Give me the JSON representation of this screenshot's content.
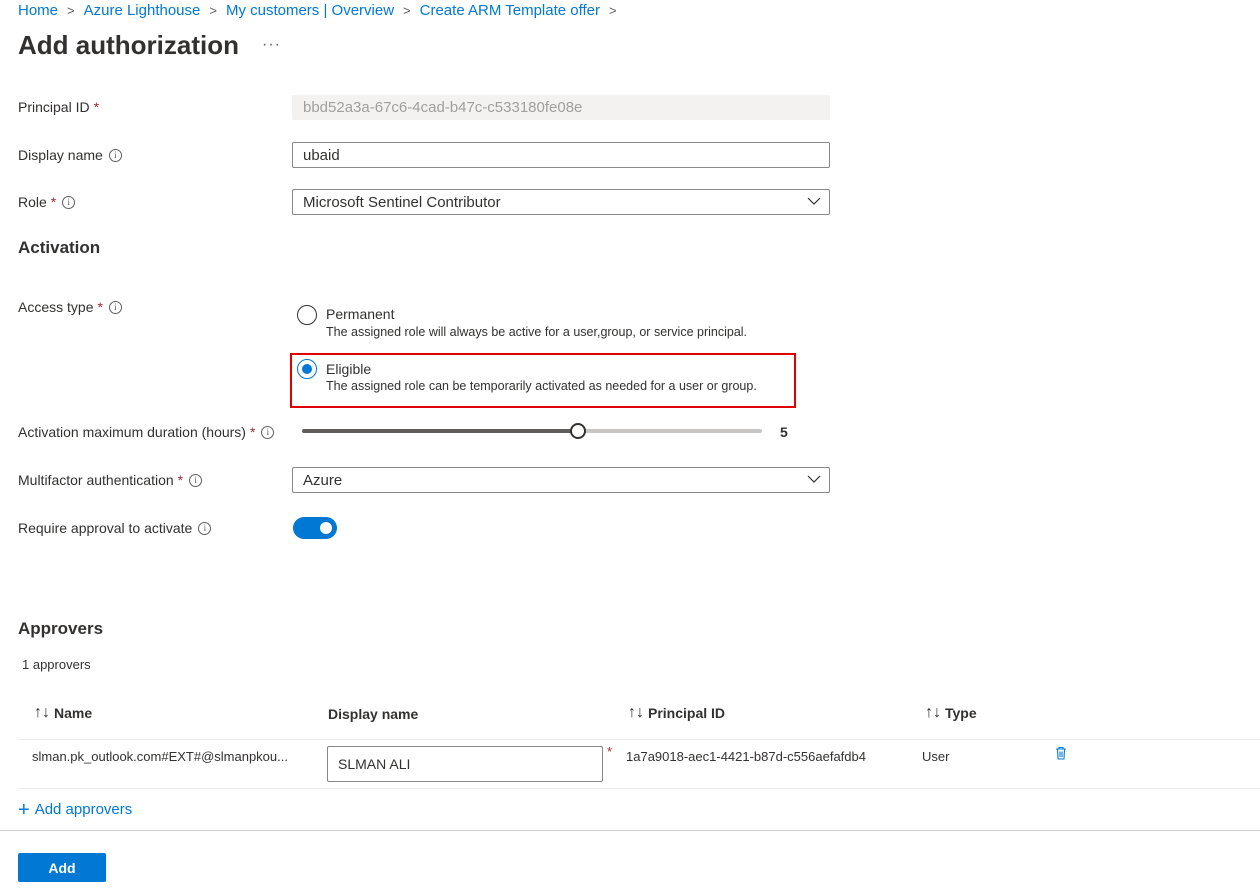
{
  "breadcrumb": [
    "Home",
    "Azure Lighthouse",
    "My customers | Overview",
    "Create ARM Template offer"
  ],
  "page_title": "Add authorization",
  "more_label": "···",
  "form": {
    "principal_id": {
      "label": "Principal ID",
      "value": "bbd52a3a-67c6-4cad-b47c-c533180fe08e"
    },
    "display_name": {
      "label": "Display name",
      "value": "ubaid"
    },
    "role": {
      "label": "Role",
      "value": "Microsoft Sentinel Contributor"
    }
  },
  "activation": {
    "heading": "Activation",
    "access_type_label": "Access type",
    "options": [
      {
        "title": "Permanent",
        "desc": "The assigned role will always be active for a user,group, or service principal.",
        "selected": false
      },
      {
        "title": "Eligible",
        "desc": "The assigned role can be temporarily activated as needed for a user or group.",
        "selected": true
      }
    ],
    "duration_label": "Activation maximum duration (hours)",
    "duration_value": "5",
    "duration_slider_fraction": 0.6,
    "mfa_label": "Multifactor authentication",
    "mfa_value": "Azure",
    "approval_label": "Require approval to activate",
    "approval_enabled": true
  },
  "approvers": {
    "heading": "Approvers",
    "count_text": "1 approvers",
    "columns": [
      "Name",
      "Display name",
      "Principal ID",
      "Type"
    ],
    "rows": [
      {
        "name": "slman.pk_outlook.com#EXT#@slmanpkou...",
        "display_name": "SLMAN ALI",
        "principal_id": "1a7a9018-aec1-4421-b87d-c556aefafdb4",
        "type": "User"
      }
    ],
    "add_label": "Add approvers"
  },
  "footer": {
    "add_button": "Add"
  },
  "colors": {
    "accent": "#0078d4",
    "required": "#a4262c",
    "highlight": "#e00000"
  }
}
